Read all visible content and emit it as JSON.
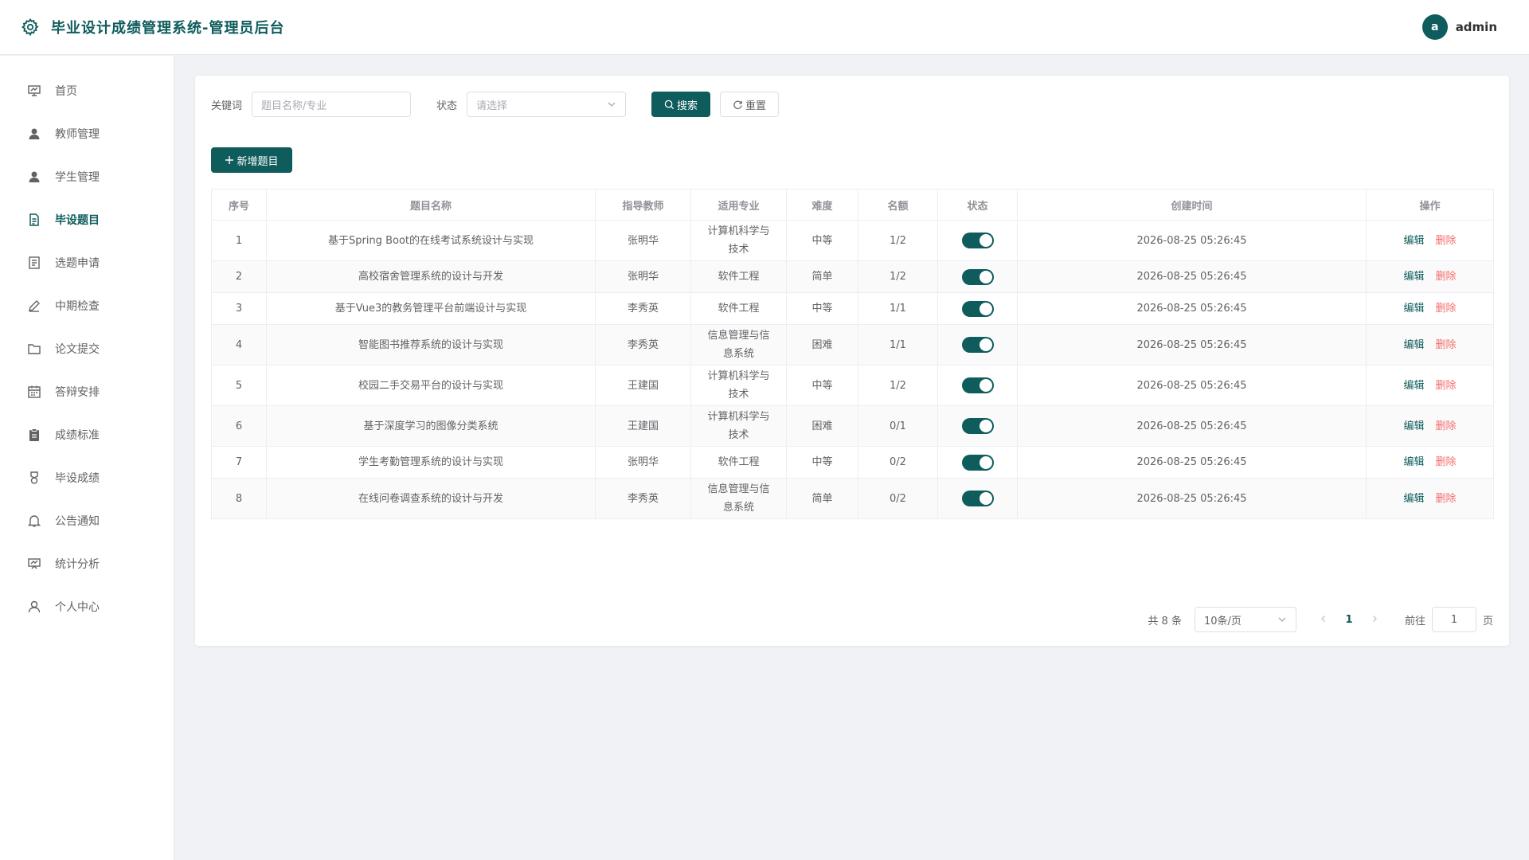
{
  "app": {
    "title": "毕业设计成绩管理系统-管理员后台",
    "accent": "#0f5c5c",
    "danger": "#f56c6c"
  },
  "user": {
    "avatar_letter": "a",
    "name": "admin"
  },
  "sidebar": {
    "items": [
      {
        "label": "首页",
        "icon": "presentation-icon",
        "active": false
      },
      {
        "label": "教师管理",
        "icon": "user-filled-icon",
        "active": false
      },
      {
        "label": "学生管理",
        "icon": "user-filled-icon",
        "active": false
      },
      {
        "label": "毕设题目",
        "icon": "document-icon",
        "active": true
      },
      {
        "label": "选题申请",
        "icon": "list-icon",
        "active": false
      },
      {
        "label": "中期检查",
        "icon": "edit-pen-icon",
        "active": false
      },
      {
        "label": "论文提交",
        "icon": "folder-icon",
        "active": false
      },
      {
        "label": "答辩安排",
        "icon": "calendar-icon",
        "active": false
      },
      {
        "label": "成绩标准",
        "icon": "clipboard-icon",
        "active": false
      },
      {
        "label": "毕设成绩",
        "icon": "medal-icon",
        "active": false
      },
      {
        "label": "公告通知",
        "icon": "bell-icon",
        "active": false
      },
      {
        "label": "统计分析",
        "icon": "data-board-icon",
        "active": false
      },
      {
        "label": "个人中心",
        "icon": "user-outline-icon",
        "active": false
      }
    ]
  },
  "filters": {
    "keyword_label": "关键词",
    "keyword_placeholder": "题目名称/专业",
    "status_label": "状态",
    "status_placeholder": "请选择",
    "search_label": "搜索",
    "reset_label": "重置"
  },
  "toolbar": {
    "add_label": "新增题目"
  },
  "table": {
    "headers": [
      "序号",
      "题目名称",
      "指导教师",
      "适用专业",
      "难度",
      "名额",
      "状态",
      "创建时间",
      "操作"
    ],
    "edit_label": "编辑",
    "delete_label": "删除",
    "rows": [
      {
        "no": "1",
        "title": "基于Spring Boot的在线考试系统设计与实现",
        "teacher": "张明华",
        "major_l1": "计算机科学与",
        "major_l2": "技术",
        "difficulty": "中等",
        "quota": "1/2",
        "enabled": true,
        "created": "2026-08-25 05:26:45"
      },
      {
        "no": "2",
        "title": "高校宿舍管理系统的设计与开发",
        "teacher": "张明华",
        "major_l1": "软件工程",
        "major_l2": "",
        "difficulty": "简单",
        "quota": "1/2",
        "enabled": true,
        "created": "2026-08-25 05:26:45"
      },
      {
        "no": "3",
        "title": "基于Vue3的教务管理平台前端设计与实现",
        "teacher": "李秀英",
        "major_l1": "软件工程",
        "major_l2": "",
        "difficulty": "中等",
        "quota": "1/1",
        "enabled": true,
        "created": "2026-08-25 05:26:45"
      },
      {
        "no": "4",
        "title": "智能图书推荐系统的设计与实现",
        "teacher": "李秀英",
        "major_l1": "信息管理与信",
        "major_l2": "息系统",
        "difficulty": "困难",
        "quota": "1/1",
        "enabled": true,
        "created": "2026-08-25 05:26:45"
      },
      {
        "no": "5",
        "title": "校园二手交易平台的设计与实现",
        "teacher": "王建国",
        "major_l1": "计算机科学与",
        "major_l2": "技术",
        "difficulty": "中等",
        "quota": "1/2",
        "enabled": true,
        "created": "2026-08-25 05:26:45"
      },
      {
        "no": "6",
        "title": "基于深度学习的图像分类系统",
        "teacher": "王建国",
        "major_l1": "计算机科学与",
        "major_l2": "技术",
        "difficulty": "困难",
        "quota": "0/1",
        "enabled": true,
        "created": "2026-08-25 05:26:45"
      },
      {
        "no": "7",
        "title": "学生考勤管理系统的设计与实现",
        "teacher": "张明华",
        "major_l1": "软件工程",
        "major_l2": "",
        "difficulty": "中等",
        "quota": "0/2",
        "enabled": true,
        "created": "2026-08-25 05:26:45"
      },
      {
        "no": "8",
        "title": "在线问卷调查系统的设计与开发",
        "teacher": "李秀英",
        "major_l1": "信息管理与信",
        "major_l2": "息系统",
        "difficulty": "简单",
        "quota": "0/2",
        "enabled": true,
        "created": "2026-08-25 05:26:45"
      }
    ]
  },
  "pagination": {
    "total_text": "共 8 条",
    "page_size": "10条/页",
    "current_page": "1",
    "goto_label": "前往",
    "goto_value": "1",
    "page_suffix": "页"
  }
}
